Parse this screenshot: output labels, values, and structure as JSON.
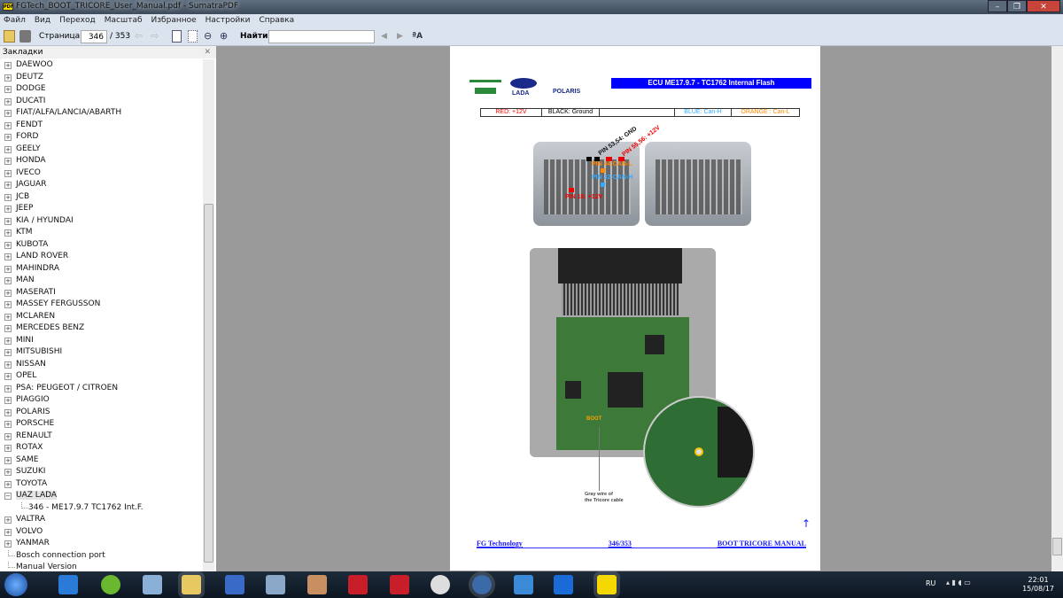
{
  "window": {
    "title": "FGTech_BOOT_TRICORE_User_Manual.pdf - SumatraPDF",
    "app_icon": "PDF"
  },
  "menu": [
    "Файл",
    "Вид",
    "Переход",
    "Масштаб",
    "Избранное",
    "Настройки",
    "Справка"
  ],
  "toolbar": {
    "page_label": "Страница:",
    "page_value": "346",
    "page_total": "/ 353",
    "find_label": "Найти:",
    "find_value": ""
  },
  "sidebar": {
    "title": "Закладки",
    "items": [
      {
        "label": "DAEWOO",
        "state": "collapsed"
      },
      {
        "label": "DEUTZ",
        "state": "collapsed"
      },
      {
        "label": "DODGE",
        "state": "collapsed"
      },
      {
        "label": "DUCATI",
        "state": "collapsed"
      },
      {
        "label": "FIAT/ALFA/LANCIA/ABARTH",
        "state": "collapsed"
      },
      {
        "label": "FENDT",
        "state": "collapsed"
      },
      {
        "label": "FORD",
        "state": "collapsed"
      },
      {
        "label": "GEELY",
        "state": "collapsed"
      },
      {
        "label": "HONDA",
        "state": "collapsed"
      },
      {
        "label": "IVECO",
        "state": "collapsed"
      },
      {
        "label": "JAGUAR",
        "state": "collapsed"
      },
      {
        "label": "JCB",
        "state": "collapsed"
      },
      {
        "label": "JEEP",
        "state": "collapsed"
      },
      {
        "label": "KIA / HYUNDAI",
        "state": "collapsed"
      },
      {
        "label": "KTM",
        "state": "collapsed"
      },
      {
        "label": "KUBOTA",
        "state": "collapsed"
      },
      {
        "label": "LAND ROVER",
        "state": "collapsed"
      },
      {
        "label": "MAHINDRA",
        "state": "collapsed"
      },
      {
        "label": "MAN",
        "state": "collapsed"
      },
      {
        "label": "MASERATI",
        "state": "collapsed"
      },
      {
        "label": "MASSEY FERGUSSON",
        "state": "collapsed"
      },
      {
        "label": "MCLAREN",
        "state": "collapsed"
      },
      {
        "label": "MERCEDES BENZ",
        "state": "collapsed"
      },
      {
        "label": "MINI",
        "state": "collapsed"
      },
      {
        "label": "MITSUBISHI",
        "state": "collapsed"
      },
      {
        "label": "NISSAN",
        "state": "collapsed"
      },
      {
        "label": "OPEL",
        "state": "collapsed"
      },
      {
        "label": "PSA: PEUGEOT / CITROEN",
        "state": "collapsed"
      },
      {
        "label": "PIAGGIO",
        "state": "collapsed"
      },
      {
        "label": "POLARIS",
        "state": "collapsed"
      },
      {
        "label": "PORSCHE",
        "state": "collapsed"
      },
      {
        "label": "RENAULT",
        "state": "collapsed"
      },
      {
        "label": "ROTAX",
        "state": "collapsed"
      },
      {
        "label": "SAME",
        "state": "collapsed"
      },
      {
        "label": "SUZUKI",
        "state": "collapsed"
      },
      {
        "label": "TOYOTA",
        "state": "collapsed"
      },
      {
        "label": "UAZ LADA",
        "state": "expanded"
      },
      {
        "label": "346 - ME17.9.7 TC1762 Int.F.",
        "state": "child"
      },
      {
        "label": "VALTRA",
        "state": "collapsed"
      },
      {
        "label": "VOLVO",
        "state": "collapsed"
      },
      {
        "label": "YANMAR",
        "state": "collapsed"
      },
      {
        "label": "Bosch connection port",
        "state": "leaf"
      },
      {
        "label": "Manual Version",
        "state": "leaf"
      }
    ]
  },
  "pdf_page": {
    "logos": [
      "UAZ",
      "LADA",
      "POLARIS"
    ],
    "banner": "ECU ME17.9.7 - TC1762 Internal Flash",
    "legend": [
      {
        "text": "RED: +12V",
        "color": "#ff0000"
      },
      {
        "text": "BLACK: Ground",
        "color": "#000000"
      },
      {
        "text": "",
        "color": "#000000"
      },
      {
        "text": "BLUE: Can-H",
        "color": "#33aaff"
      },
      {
        "text": "ORANGE : Can-L",
        "color": "#ff8800"
      }
    ],
    "pins": {
      "gnd": "PIN 53,54: GND",
      "v12a": "PIN 55,56: +12V",
      "canl": "PIN 44:CAN-L",
      "canh": "PIN 32:CAN-H",
      "v12b": "PIN 16: +12V"
    },
    "boot_label": "BOOT",
    "wire_note_1": "Gray wire of",
    "wire_note_2": "the Tricore cable",
    "arrow": "↑",
    "footer": {
      "left": "FG Technology",
      "center": "346/353",
      "right": "BOOT TRICORE MANUAL"
    }
  },
  "tray": {
    "lang": "RU",
    "time": "22:01",
    "date": "15/08/17"
  }
}
